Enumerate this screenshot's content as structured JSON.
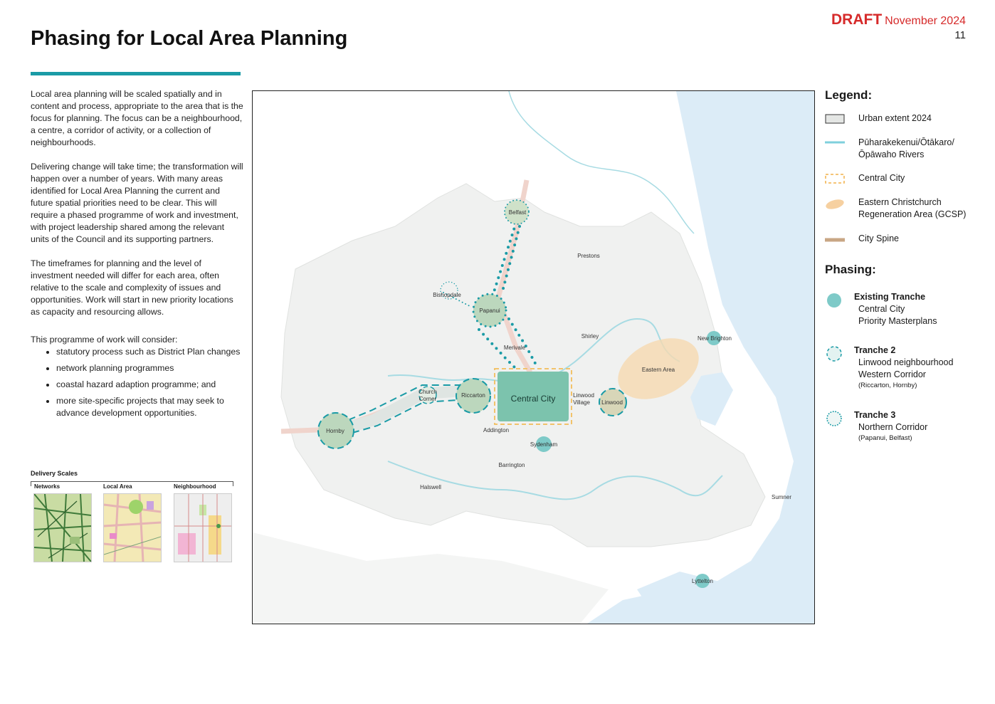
{
  "header": {
    "draft_label": "DRAFT",
    "date": "November 2024",
    "page_number": "11",
    "title": "Phasing for Local Area Planning"
  },
  "body": {
    "paragraphs": [
      "Local area planning will be scaled spatially and in content and process, appropriate to the area that is the focus for planning. The focus can be a neighbourhood, a centre, a corridor of activity, or a collection of neighbourhoods.",
      "Delivering change will take time; the transformation will happen over a number of years. With many areas identified for Local Area Planning the current and future spatial priorities need to be clear. This will require a phased programme of work and investment, with project leadership shared among the relevant units of the Council and its supporting partners.",
      "The timeframes for planning and the level of investment needed will differ for each area, often relative to the scale and complexity of issues and opportunities. Work will start in new priority locations as capacity and resourcing allows.",
      "This programme of work will consider:"
    ],
    "bullets": [
      "statutory process such as District Plan changes",
      "network planning programmes",
      "coastal hazard adaption programme; and",
      "more site-specific projects that may seek to advance development opportunities."
    ]
  },
  "delivery_scales": {
    "title": "Delivery Scales",
    "labels": [
      "Networks",
      "Local Area",
      "Neighbourhood"
    ]
  },
  "map": {
    "central_city_label": "Central City",
    "places": {
      "belfast": "Belfast",
      "prestons": "Prestons",
      "bishopdale": "Bishopdale",
      "papanui": "Papanui",
      "shirley": "Shirley",
      "new_brighton": "New Brighton",
      "merivale": "Merivale",
      "eastern_area": "Eastern Area",
      "church_corner_1": "Church",
      "church_corner_2": "Corner",
      "riccarton": "Riccarton",
      "linwood_village_1": "Linwood",
      "linwood_village_2": "Village",
      "linwood": "Linwood",
      "hornby": "Hornby",
      "addington": "Addington",
      "sydenham": "Sydenham",
      "barrington": "Barrington",
      "halswell": "Halswell",
      "sumner": "Sumner",
      "lyttelton": "Lyttelton"
    }
  },
  "legend": {
    "title": "Legend:",
    "items": [
      {
        "label": "Urban extent 2024",
        "icon": "urban-extent-swatch"
      },
      {
        "label": "Pūharakekenui/Ōtākaro/ Ōpāwaho Rivers",
        "icon": "river-line"
      },
      {
        "label": "Central City",
        "icon": "dashed-orange-box"
      },
      {
        "label": "Eastern Christchurch Regeneration Area (GCSP)",
        "icon": "orange-blob"
      },
      {
        "label": "City Spine",
        "icon": "tan-line"
      }
    ],
    "phasing_title": "Phasing:",
    "phasing": [
      {
        "name": "Existing Tranche",
        "lines": [
          "Central City",
          "Priority Masterplans"
        ],
        "note": ""
      },
      {
        "name": "Tranche 2",
        "lines": [
          "Linwood neighbourhood",
          "Western Corridor"
        ],
        "note": "(Riccarton, Hornby)"
      },
      {
        "name": "Tranche 3",
        "lines": [
          "Northern Corridor"
        ],
        "note": "(Papanui, Belfast)"
      }
    ]
  },
  "colors": {
    "teal": "#1a9ba6",
    "draft_red": "#d62a2a",
    "central_city_fill": "#7cc3ad",
    "river": "#8fd6e0",
    "sea": "#dcecf7",
    "urban": "#f0f1f0",
    "spine": "#e8c0b0",
    "eastern_area": "#f6d9b0"
  }
}
